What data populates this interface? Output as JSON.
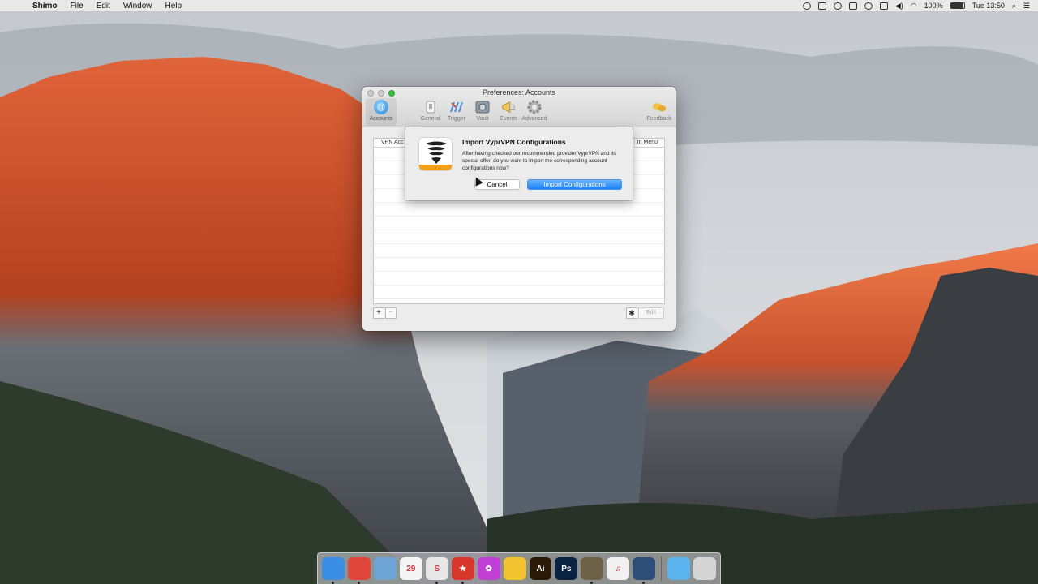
{
  "menubar": {
    "apple_glyph": "",
    "app_name": "Shimo",
    "menus": [
      "File",
      "Edit",
      "Window",
      "Help"
    ],
    "battery": "100%",
    "clock": "Tue 13:50",
    "icons": [
      "record-icon",
      "dropbox-icon",
      "shimo-icon",
      "blank-icon",
      "people-icon",
      "airplay-icon",
      "volume-icon",
      "wifi-icon",
      "battery-icon",
      "search-icon",
      "notifications-icon"
    ]
  },
  "window": {
    "title": "Preferences: Accounts",
    "toolbar": [
      {
        "label": "Accounts",
        "icon": "at-icon",
        "active": true
      },
      {
        "label": "General",
        "icon": "switch-icon"
      },
      {
        "label": "Trigger",
        "icon": "trigger-icon"
      },
      {
        "label": "Vault",
        "icon": "vault-icon"
      },
      {
        "label": "Events",
        "icon": "megaphone-icon"
      },
      {
        "label": "Advanced",
        "icon": "gear-icon"
      }
    ],
    "feedback_label": "Feedback",
    "table": {
      "col_left": "VPN Acc",
      "col_right": "In Menu"
    },
    "bottom": {
      "add": "+",
      "remove": "−",
      "gear": "✱",
      "edit": "Edit"
    }
  },
  "sheet": {
    "title": "Import VyprVPN Configurations",
    "message": "After having checked our recommended provider VyprVPN and its special offer, do you want to import the corresponding account configurations now?",
    "cancel": "Cancel",
    "import": "Import Configurations"
  },
  "dock": {
    "items": [
      {
        "name": "finder",
        "color": "#3a8ee6",
        "label": "",
        "running": true
      },
      {
        "name": "chrome",
        "color": "#e0463a",
        "label": "",
        "running": true
      },
      {
        "name": "preview",
        "color": "#6fa4d6",
        "label": "",
        "running": false
      },
      {
        "name": "calendar",
        "color": "#f5f5f5",
        "label": "29",
        "running": false
      },
      {
        "name": "slack",
        "color": "#e8e8e8",
        "label": "S",
        "running": true
      },
      {
        "name": "wunderlist",
        "color": "#d9372c",
        "label": "★",
        "running": true
      },
      {
        "name": "flower-app",
        "color": "#c13fd6",
        "label": "✿",
        "running": false
      },
      {
        "name": "duck-app",
        "color": "#f2c230",
        "label": "",
        "running": false
      },
      {
        "name": "illustrator",
        "color": "#2b1a05",
        "label": "Ai",
        "running": false
      },
      {
        "name": "photoshop",
        "color": "#0a2340",
        "label": "Ps",
        "running": false
      },
      {
        "name": "tunnel-app",
        "color": "#6d6248",
        "label": "",
        "running": true
      },
      {
        "name": "itunes",
        "color": "#f1f1f1",
        "label": "♫",
        "running": false
      },
      {
        "name": "quicktime",
        "color": "#2d4f77",
        "label": "",
        "running": true
      }
    ],
    "right_items": [
      {
        "name": "downloads-folder",
        "color": "#5bb4f0",
        "label": ""
      },
      {
        "name": "trash",
        "color": "#d5d5d5",
        "label": ""
      }
    ]
  },
  "colors": {
    "accent": "#1a82f7",
    "close_light": "#cfcfcf",
    "zoom_light": "#3fc23e",
    "vypr_orange": "#f0a01e"
  }
}
